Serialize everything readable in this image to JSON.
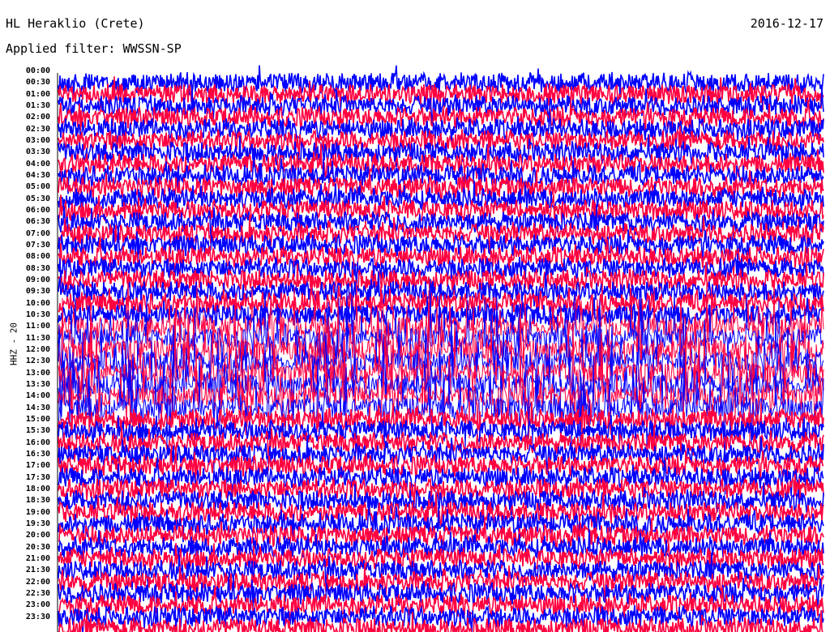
{
  "header": {
    "station": "HL Heraklio (Crete)",
    "date": "2016-12-17",
    "filter": "Applied filter: WWSSN-SP"
  },
  "chart_data": {
    "type": "line",
    "title": "HL Heraklio (Crete)",
    "subtitle": "Applied filter: WWSSN-SP",
    "ylabel": "HHZ - 20",
    "xlabel": "",
    "colors": [
      "#0000ff",
      "#ff0040"
    ],
    "y_tick_labels": [
      "00:00",
      "00:30",
      "01:00",
      "01:30",
      "02:00",
      "02:30",
      "03:00",
      "03:30",
      "04:00",
      "04:30",
      "05:00",
      "05:30",
      "06:00",
      "06:30",
      "07:00",
      "07:30",
      "08:00",
      "08:30",
      "09:00",
      "09:30",
      "10:00",
      "10:30",
      "11:00",
      "11:30",
      "12:00",
      "12:30",
      "13:00",
      "13:30",
      "14:00",
      "14:30",
      "15:00",
      "15:30",
      "16:00",
      "16:30",
      "17:00",
      "17:30",
      "18:00",
      "18:30",
      "19:00",
      "19:30",
      "20:00",
      "20:30",
      "21:00",
      "21:30",
      "22:00",
      "22:30",
      "23:00",
      "23:30"
    ],
    "high_amplitude_window": [
      "10:30",
      "14:30"
    ]
  }
}
